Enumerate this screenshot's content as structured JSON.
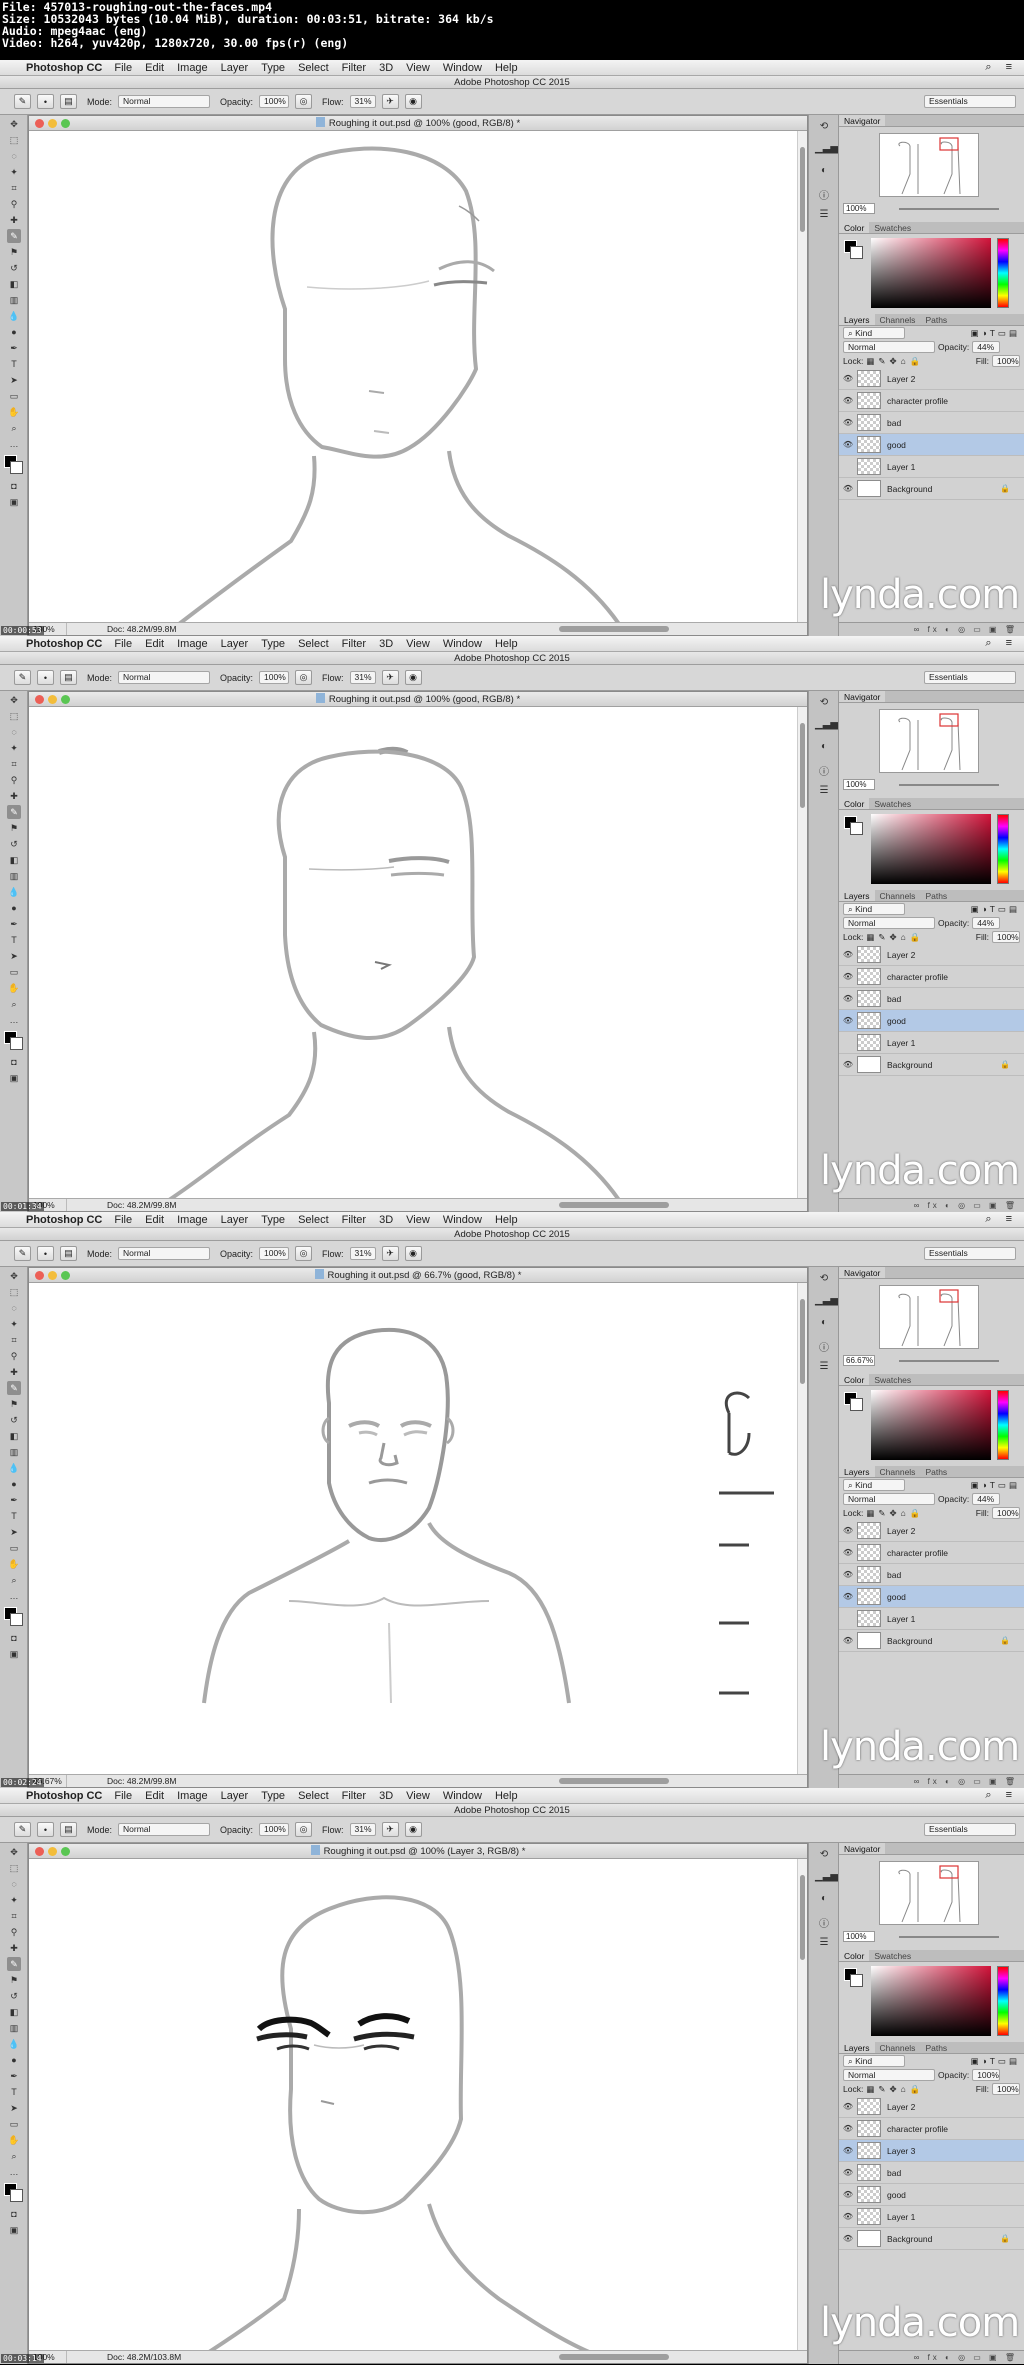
{
  "file_info": [
    "File: 457013-roughing-out-the-faces.mp4",
    "Size: 10532043 bytes (10.04 MiB), duration: 00:03:51, bitrate: 364 kb/s",
    "Audio: mpeg4aac (eng)",
    "Video: h264, yuv420p, 1280x720, 30.00 fps(r) (eng)"
  ],
  "app": {
    "name": "Photoshop CC",
    "window_title": "Adobe Photoshop CC 2015",
    "menu": [
      "File",
      "Edit",
      "Image",
      "Layer",
      "Type",
      "Select",
      "Filter",
      "3D",
      "View",
      "Window",
      "Help"
    ]
  },
  "options": {
    "mode_label": "Mode:",
    "mode_value": "Normal",
    "opacity_label": "Opacity:",
    "opacity_value": "100%",
    "flow_label": "Flow:",
    "flow_value": "31%",
    "workspace": "Essentials"
  },
  "panels": {
    "navigator_tab": "Navigator",
    "color_tab": "Color",
    "swatches_tab": "Swatches",
    "layers_tab": "Layers",
    "channels_tab": "Channels",
    "paths_tab": "Paths",
    "kind_label": "Kind",
    "blend_mode": "Normal",
    "opacity_label": "Opacity:",
    "lock_label": "Lock:",
    "fill_label": "Fill:",
    "fill_value": "100%"
  },
  "watermark": "lynda.com",
  "frames": [
    {
      "timecode": "00:00:53",
      "doc_title": "Roughing it out.psd @ 100% (good, RGB/8) *",
      "zoom": "100%",
      "doc_info": "Doc: 48.2M/99.8M",
      "nav_zoom": "100%",
      "layer_opacity": "44%",
      "layers": [
        {
          "name": "Layer 2",
          "visible": true,
          "selected": false
        },
        {
          "name": "character profile",
          "visible": true,
          "selected": false
        },
        {
          "name": "bad",
          "visible": true,
          "selected": false
        },
        {
          "name": "good",
          "visible": true,
          "selected": true
        },
        {
          "name": "Layer 1",
          "visible": false,
          "selected": false
        },
        {
          "name": "Background",
          "visible": true,
          "selected": false,
          "locked": true
        }
      ]
    },
    {
      "timecode": "00:01:34",
      "doc_title": "Roughing it out.psd @ 100% (good, RGB/8) *",
      "zoom": "100%",
      "doc_info": "Doc: 48.2M/99.8M",
      "nav_zoom": "100%",
      "layer_opacity": "44%",
      "layers": [
        {
          "name": "Layer 2",
          "visible": true,
          "selected": false
        },
        {
          "name": "character profile",
          "visible": true,
          "selected": false
        },
        {
          "name": "bad",
          "visible": true,
          "selected": false
        },
        {
          "name": "good",
          "visible": true,
          "selected": true
        },
        {
          "name": "Layer 1",
          "visible": false,
          "selected": false
        },
        {
          "name": "Background",
          "visible": true,
          "selected": false,
          "locked": true
        }
      ]
    },
    {
      "timecode": "00:02:24",
      "doc_title": "Roughing it out.psd @ 66.7% (good, RGB/8) *",
      "zoom": "66.67%",
      "doc_info": "Doc: 48.2M/99.8M",
      "nav_zoom": "66.67%",
      "layer_opacity": "44%",
      "layers": [
        {
          "name": "Layer 2",
          "visible": true,
          "selected": false
        },
        {
          "name": "character profile",
          "visible": true,
          "selected": false
        },
        {
          "name": "bad",
          "visible": true,
          "selected": false
        },
        {
          "name": "good",
          "visible": true,
          "selected": true
        },
        {
          "name": "Layer 1",
          "visible": false,
          "selected": false
        },
        {
          "name": "Background",
          "visible": true,
          "selected": false,
          "locked": true
        }
      ]
    },
    {
      "timecode": "00:03:14",
      "doc_title": "Roughing it out.psd @ 100% (Layer 3, RGB/8) *",
      "zoom": "100%",
      "doc_info": "Doc: 48.2M/103.8M",
      "nav_zoom": "100%",
      "layer_opacity": "100%",
      "layers": [
        {
          "name": "Layer 2",
          "visible": true,
          "selected": false
        },
        {
          "name": "character profile",
          "visible": true,
          "selected": false
        },
        {
          "name": "Layer 3",
          "visible": true,
          "selected": true
        },
        {
          "name": "bad",
          "visible": true,
          "selected": false
        },
        {
          "name": "good",
          "visible": true,
          "selected": false
        },
        {
          "name": "Layer 1",
          "visible": true,
          "selected": false
        },
        {
          "name": "Background",
          "visible": true,
          "selected": false,
          "locked": true
        }
      ]
    }
  ]
}
